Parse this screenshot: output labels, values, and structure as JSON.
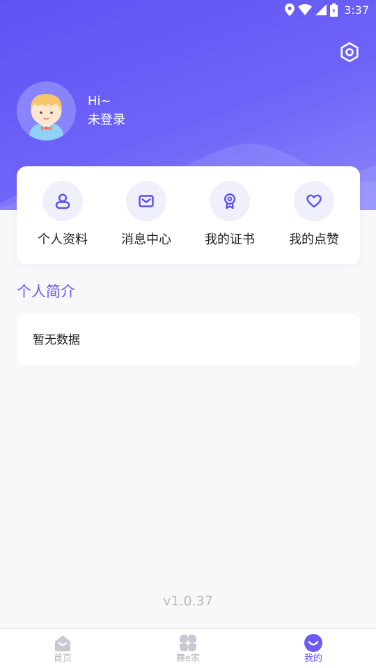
{
  "status_bar": {
    "time": "3:37",
    "icons": [
      "location-icon",
      "wifi-icon",
      "cellular-signal-icon",
      "battery-icon"
    ]
  },
  "header": {
    "settings_icon": "hexagon-settings-icon",
    "avatar_icon": "cartoon-avatar-icon",
    "greeting": "Hi~",
    "login_status": "未登录"
  },
  "menu": [
    {
      "label": "个人资料",
      "icon": "user-icon"
    },
    {
      "label": "消息中心",
      "icon": "mail-icon"
    },
    {
      "label": "我的证书",
      "icon": "certificate-icon"
    },
    {
      "label": "我的点赞",
      "icon": "heart-icon"
    }
  ],
  "intro": {
    "title": "个人简介",
    "empty_text": "暂无数据"
  },
  "version": "v1.0.37",
  "tabs": [
    {
      "label": "首页",
      "icon": "home-icon",
      "active": false
    },
    {
      "label": "舞e家",
      "icon": "grid-icon",
      "active": false
    },
    {
      "label": "我的",
      "icon": "smile-icon",
      "active": true
    }
  ],
  "colors": {
    "accent": "#6b5cf6",
    "header_gradient_start": "#5f52f5",
    "header_gradient_end": "#8b85fb",
    "menu_circle_bg": "#eff0fb",
    "tab_inactive": "#c8c8d0",
    "version_text": "#b9b9c2"
  }
}
